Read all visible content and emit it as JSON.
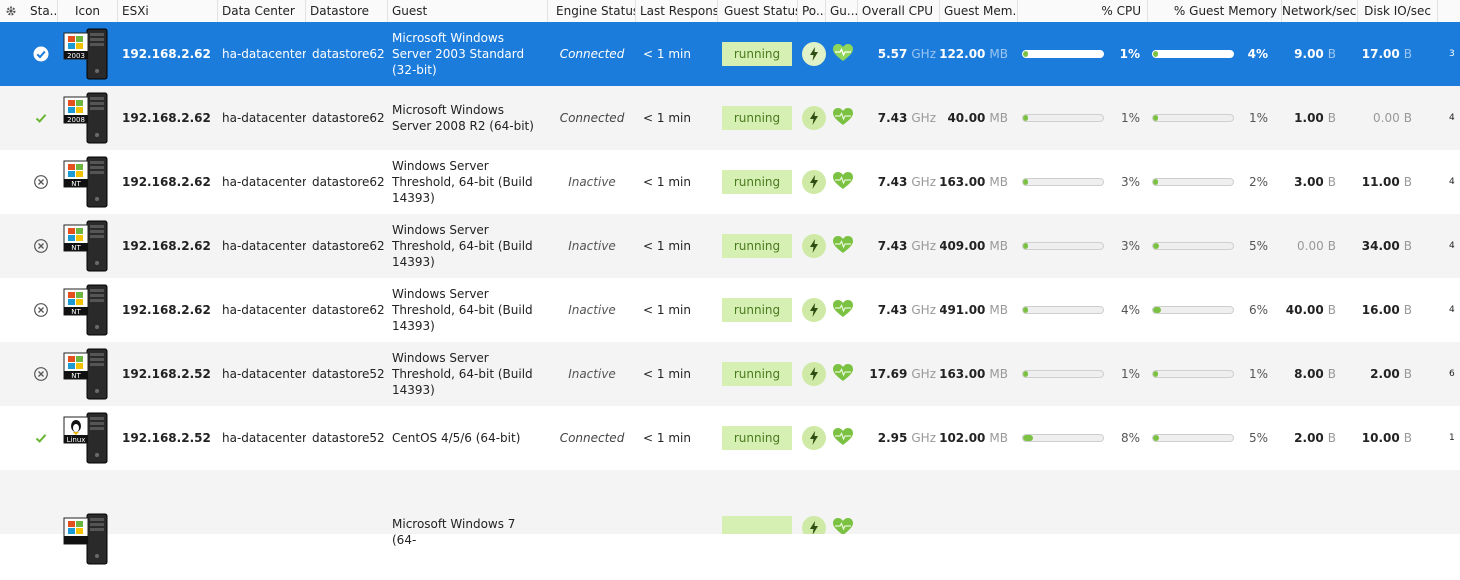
{
  "headers": {
    "status": "Sta...",
    "icon": "Icon",
    "esxi": "ESXi",
    "datacenter": "Data Center",
    "datastore": "Datastore",
    "guest": "Guest",
    "engine_status": "Engine Status",
    "last_response": "Last Response",
    "guest_status": "Guest Status",
    "power": "Po...",
    "guest_health": "Gu...",
    "overall_cpu": "Overall CPU",
    "guest_memory": "Guest Mem...",
    "pct_cpu": "% CPU",
    "pct_guest_memory": "% Guest Memory",
    "network": "Network/sec",
    "disk_io": "Disk IO/sec"
  },
  "colors": {
    "selected_row": "#1c7cdb",
    "running_badge": "#d6f0b4",
    "bar_fill": "#7bc142",
    "check_green": "#6bb536"
  },
  "rows": [
    {
      "status": "check-circle",
      "os_badge": "2003",
      "esxi": "192.168.2.62",
      "datacenter": "ha-datacenter",
      "datastore": "datastore62",
      "guest": "Microsoft Windows Server 2003 Standard (32-bit)",
      "engine": "Connected",
      "last_response": "< 1 min",
      "guest_status": "running",
      "cpu_value": "5.57",
      "cpu_unit": "GHz",
      "mem_value": "122.00",
      "mem_unit": "MB",
      "pct_cpu": "1%",
      "pct_cpu_fill": 0.01,
      "pct_mem": "4%",
      "pct_mem_fill": 0.04,
      "net_value": "9.00",
      "net_unit": "B",
      "disk_value": "17.00",
      "disk_unit": "B",
      "extra": "3",
      "selected": true
    },
    {
      "status": "check",
      "os_badge": "2008",
      "esxi": "192.168.2.62",
      "datacenter": "ha-datacenter",
      "datastore": "datastore62",
      "guest": "Microsoft Windows Server 2008 R2 (64-bit)",
      "engine": "Connected",
      "last_response": "< 1 min",
      "guest_status": "running",
      "cpu_value": "7.43",
      "cpu_unit": "GHz",
      "mem_value": "40.00",
      "mem_unit": "MB",
      "pct_cpu": "1%",
      "pct_cpu_fill": 0.01,
      "pct_mem": "1%",
      "pct_mem_fill": 0.01,
      "net_value": "1.00",
      "net_unit": "B",
      "disk_value": "0.00",
      "disk_unit": "B",
      "extra": "4"
    },
    {
      "status": "x-circle",
      "os_badge": "NT",
      "esxi": "192.168.2.62",
      "datacenter": "ha-datacenter",
      "datastore": "datastore62",
      "guest": "Windows Server Threshold, 64-bit (Build 14393)",
      "engine": "Inactive",
      "last_response": "< 1 min",
      "guest_status": "running",
      "cpu_value": "7.43",
      "cpu_unit": "GHz",
      "mem_value": "163.00",
      "mem_unit": "MB",
      "pct_cpu": "3%",
      "pct_cpu_fill": 0.03,
      "pct_mem": "2%",
      "pct_mem_fill": 0.02,
      "net_value": "3.00",
      "net_unit": "B",
      "disk_value": "11.00",
      "disk_unit": "B",
      "extra": "4"
    },
    {
      "status": "x-circle",
      "os_badge": "NT",
      "esxi": "192.168.2.62",
      "datacenter": "ha-datacenter",
      "datastore": "datastore62",
      "guest": "Windows Server Threshold, 64-bit (Build 14393)",
      "engine": "Inactive",
      "last_response": "< 1 min",
      "guest_status": "running",
      "cpu_value": "7.43",
      "cpu_unit": "GHz",
      "mem_value": "409.00",
      "mem_unit": "MB",
      "pct_cpu": "3%",
      "pct_cpu_fill": 0.03,
      "pct_mem": "5%",
      "pct_mem_fill": 0.05,
      "net_value": "0.00",
      "net_unit": "B",
      "disk_value": "34.00",
      "disk_unit": "B",
      "extra": "4"
    },
    {
      "status": "x-circle",
      "os_badge": "NT",
      "esxi": "192.168.2.62",
      "datacenter": "ha-datacenter",
      "datastore": "datastore62",
      "guest": "Windows Server Threshold, 64-bit (Build 14393)",
      "engine": "Inactive",
      "last_response": "< 1 min",
      "guest_status": "running",
      "cpu_value": "7.43",
      "cpu_unit": "GHz",
      "mem_value": "491.00",
      "mem_unit": "MB",
      "pct_cpu": "4%",
      "pct_cpu_fill": 0.04,
      "pct_mem": "6%",
      "pct_mem_fill": 0.06,
      "net_value": "40.00",
      "net_unit": "B",
      "disk_value": "16.00",
      "disk_unit": "B",
      "extra": "4"
    },
    {
      "status": "x-circle",
      "os_badge": "NT",
      "esxi": "192.168.2.52",
      "datacenter": "ha-datacenter",
      "datastore": "datastore52",
      "guest": "Windows Server Threshold, 64-bit (Build 14393)",
      "engine": "Inactive",
      "last_response": "< 1 min",
      "guest_status": "running",
      "cpu_value": "17.69",
      "cpu_unit": "GHz",
      "mem_value": "163.00",
      "mem_unit": "MB",
      "pct_cpu": "1%",
      "pct_cpu_fill": 0.01,
      "pct_mem": "1%",
      "pct_mem_fill": 0.01,
      "net_value": "8.00",
      "net_unit": "B",
      "disk_value": "2.00",
      "disk_unit": "B",
      "extra": "6"
    },
    {
      "status": "check",
      "os_badge": "Linux",
      "esxi": "192.168.2.52",
      "datacenter": "ha-datacenter",
      "datastore": "datastore52",
      "guest": "CentOS 4/5/6 (64-bit)",
      "engine": "Connected",
      "last_response": "< 1 min",
      "guest_status": "running",
      "cpu_value": "2.95",
      "cpu_unit": "GHz",
      "mem_value": "102.00",
      "mem_unit": "MB",
      "pct_cpu": "8%",
      "pct_cpu_fill": 0.08,
      "pct_mem": "5%",
      "pct_mem_fill": 0.05,
      "net_value": "2.00",
      "net_unit": "B",
      "disk_value": "10.00",
      "disk_unit": "B",
      "extra": "1"
    },
    {
      "status": "",
      "os_badge": "7",
      "esxi": "",
      "datacenter": "",
      "datastore": "",
      "guest": "Microsoft Windows 7 (64-",
      "engine": "",
      "last_response": "",
      "guest_status": "",
      "cpu_value": "",
      "cpu_unit": "",
      "mem_value": "",
      "mem_unit": "",
      "pct_cpu": "",
      "pct_cpu_fill": 0,
      "pct_mem": "",
      "pct_mem_fill": 0,
      "net_value": "",
      "net_unit": "",
      "disk_value": "",
      "disk_unit": "",
      "extra": "",
      "partial": true
    }
  ]
}
